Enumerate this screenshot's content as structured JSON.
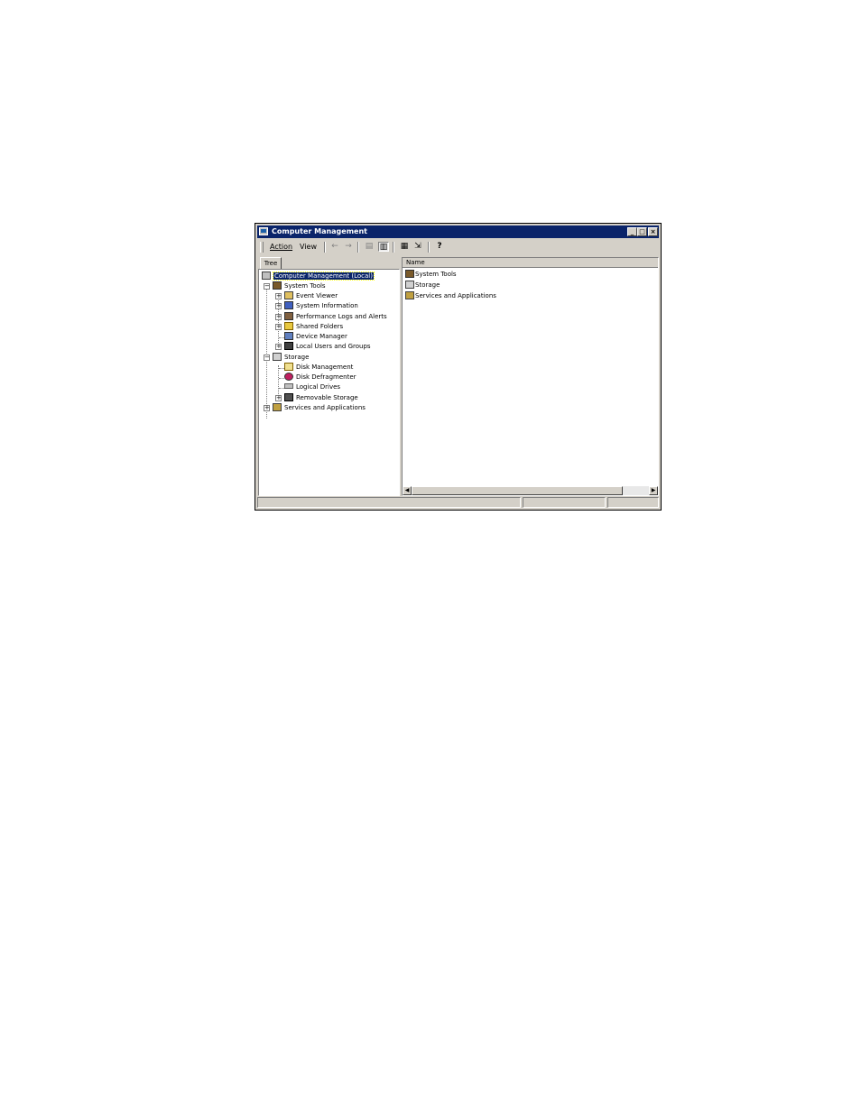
{
  "window": {
    "title": "Computer Management",
    "minimize_label": "_",
    "maximize_label": "□",
    "close_label": "×"
  },
  "menu": {
    "action": "Action",
    "view": "View"
  },
  "toolbar": {
    "back_glyph": "←",
    "forward_glyph": "→",
    "up_glyph": "▤",
    "show_tree_glyph": "▥",
    "properties_glyph": "▦",
    "export_glyph": "⇲",
    "help_glyph": "?"
  },
  "tree": {
    "tab_label": "Tree",
    "root": "Computer Management (Local)",
    "system_tools": "System Tools",
    "event_viewer": "Event Viewer",
    "system_information": "System Information",
    "performance_logs": "Performance Logs and Alerts",
    "shared_folders": "Shared Folders",
    "device_manager": "Device Manager",
    "local_users": "Local Users and Groups",
    "storage": "Storage",
    "disk_management": "Disk Management",
    "disk_defragmenter": "Disk Defragmenter",
    "logical_drives": "Logical Drives",
    "removable_storage": "Removable Storage",
    "services_apps": "Services and Applications",
    "expand_glyph": "+",
    "collapse_glyph": "−"
  },
  "list": {
    "column_name": "Name",
    "items": [
      "System Tools",
      "Storage",
      "Services and Applications"
    ]
  },
  "icons": {
    "computer": "computer-icon",
    "tools": "system-tools-icon",
    "storage": "storage-icon",
    "services": "services-icon"
  }
}
